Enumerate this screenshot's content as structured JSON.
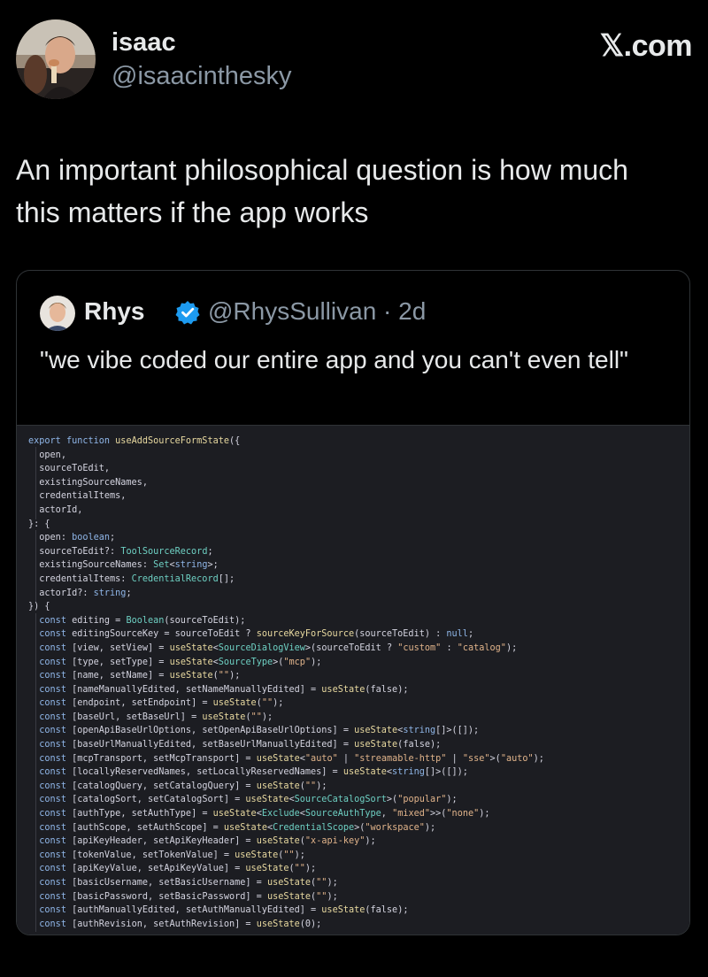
{
  "author": {
    "name": "isaac",
    "handle": "@isaacinthesky"
  },
  "site": {
    "logo": "𝕏.com"
  },
  "tweet": {
    "text": "An important philosophical question is how much this matters if the app works"
  },
  "quoted": {
    "name": "Rhys",
    "handle": "@RhysSullivan · 2d",
    "verified_color": "#1d9bf0",
    "text": "\"we vibe coded our entire app and you can't even tell\""
  },
  "code_lines": [
    "export function useAddSourceFormState({",
    "  open,",
    "  sourceToEdit,",
    "  existingSourceNames,",
    "  credentialItems,",
    "  actorId,",
    "}: {",
    "  open: boolean;",
    "  sourceToEdit?: ToolSourceRecord;",
    "  existingSourceNames: Set<string>;",
    "  credentialItems: CredentialRecord[];",
    "  actorId?: string;",
    "}) {",
    "  const editing = Boolean(sourceToEdit);",
    "  const editingSourceKey = sourceToEdit ? sourceKeyForSource(sourceToEdit) : null;",
    "  const [view, setView] = useState<SourceDialogView>(sourceToEdit ? \"custom\" : \"catalog\");",
    "  const [type, setType] = useState<SourceType>(\"mcp\");",
    "  const [name, setName] = useState(\"\");",
    "  const [nameManuallyEdited, setNameManuallyEdited] = useState(false);",
    "  const [endpoint, setEndpoint] = useState(\"\");",
    "  const [baseUrl, setBaseUrl] = useState(\"\");",
    "  const [openApiBaseUrlOptions, setOpenApiBaseUrlOptions] = useState<string[]>([]);",
    "  const [baseUrlManuallyEdited, setBaseUrlManuallyEdited] = useState(false);",
    "  const [mcpTransport, setMcpTransport] = useState<\"auto\" | \"streamable-http\" | \"sse\">(\"auto\");",
    "  const [locallyReservedNames, setLocallyReservedNames] = useState<string[]>([]);",
    "  const [catalogQuery, setCatalogQuery] = useState(\"\");",
    "  const [catalogSort, setCatalogSort] = useState<SourceCatalogSort>(\"popular\");",
    "  const [authType, setAuthType] = useState<Exclude<SourceAuthType, \"mixed\">>(\"none\");",
    "  const [authScope, setAuthScope] = useState<CredentialScope>(\"workspace\");",
    "  const [apiKeyHeader, setApiKeyHeader] = useState(\"x-api-key\");",
    "  const [tokenValue, setTokenValue] = useState(\"\");",
    "  const [apiKeyValue, setApiKeyValue] = useState(\"\");",
    "  const [basicUsername, setBasicUsername] = useState(\"\");",
    "  const [basicPassword, setBasicPassword] = useState(\"\");",
    "  const [authManuallyEdited, setAuthManuallyEdited] = useState(false);",
    "  const [authRevision, setAuthRevision] = useState(0);"
  ]
}
